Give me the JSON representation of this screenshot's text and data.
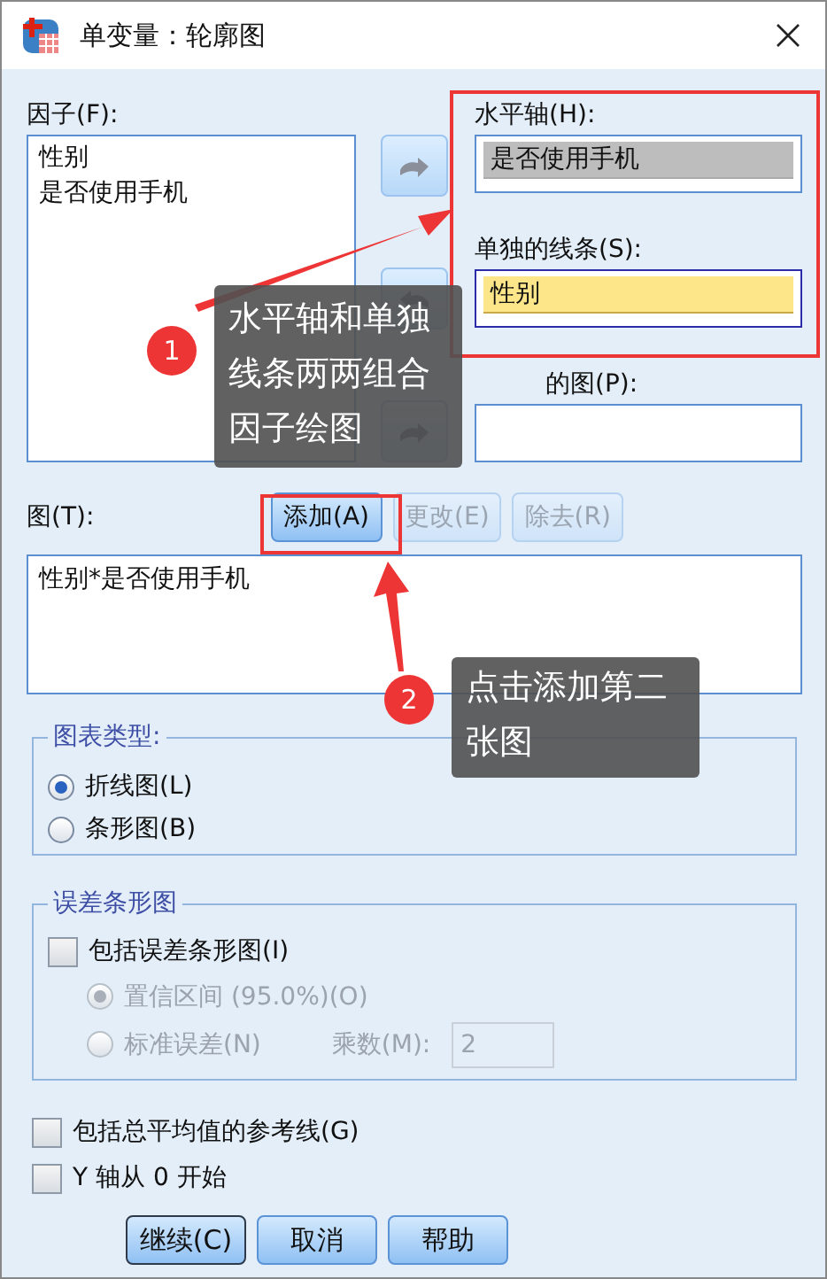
{
  "window": {
    "title": "单变量：轮廓图"
  },
  "factors": {
    "label": "因子(F):",
    "items": [
      "性别",
      "是否使用手机"
    ]
  },
  "horizontal_axis": {
    "label": "水平轴(H):",
    "value": "是否使用手机",
    "focused": false
  },
  "separate_lines": {
    "label": "单独的线条(S):",
    "value": "性别",
    "focused": true
  },
  "separate_plots": {
    "label": "的图(P):"
  },
  "plots": {
    "label": "图(T):",
    "buttons": [
      {
        "label": "添加(A)",
        "disabled": false
      },
      {
        "label": "更改(E)",
        "disabled": true
      },
      {
        "label": "除去(R)",
        "disabled": true
      }
    ],
    "items": [
      "性别*是否使用手机"
    ]
  },
  "chart_type": {
    "title": "图表类型:",
    "options": [
      {
        "label": "折线图(L)",
        "selected": true
      },
      {
        "label": "条形图(B)",
        "selected": false
      }
    ]
  },
  "error_bars": {
    "title": "误差条形图",
    "include": {
      "label": "包括误差条形图(I)",
      "checked": false
    },
    "options": [
      {
        "label": "置信区间 (95.0%)(O)",
        "selected": true,
        "disabled": true
      },
      {
        "label": "标准误差(N)",
        "selected": false,
        "disabled": true
      }
    ],
    "multiplier": {
      "label": "乘数(M):",
      "value": "2",
      "disabled": true
    }
  },
  "options": [
    {
      "label": "包括总平均值的参考线(G)",
      "checked": false
    },
    {
      "label": "Y 轴从 0 开始",
      "checked": false
    }
  ],
  "buttons": [
    {
      "label": "继续(C)",
      "default": true
    },
    {
      "label": "取消",
      "default": false
    },
    {
      "label": "帮助",
      "default": false
    }
  ],
  "annotations": [
    {
      "number": "1",
      "text": "水平轴和单独线条两两组合因子绘图"
    },
    {
      "number": "2",
      "text": "点击添加第二张图"
    }
  ]
}
